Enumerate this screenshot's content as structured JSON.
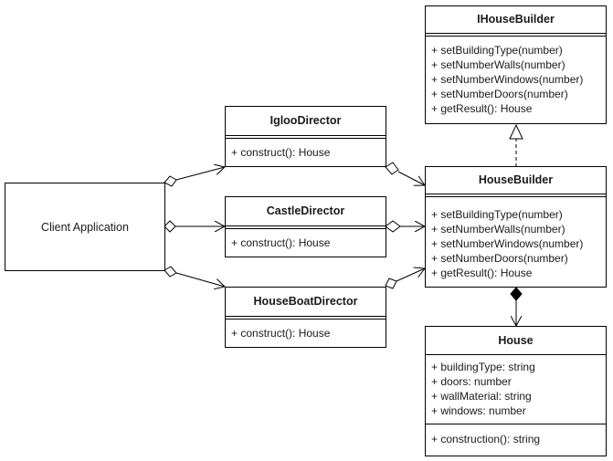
{
  "client": {
    "label": "Client Application"
  },
  "directors": [
    {
      "name": "IglooDirector",
      "methods": [
        "+ construct(): House"
      ]
    },
    {
      "name": "CastleDirector",
      "methods": [
        "+ construct(): House"
      ]
    },
    {
      "name": "HouseBoatDirector",
      "methods": [
        "+ construct(): House"
      ]
    }
  ],
  "interface": {
    "name": "IHouseBuilder",
    "methods": [
      "+ setBuildingType(number)",
      "+ setNumberWalls(number)",
      "+ setNumberWindows(number)",
      "+ setNumberDoors(number)",
      "+ getResult(): House"
    ]
  },
  "builder": {
    "name": "HouseBuilder",
    "methods": [
      "+ setBuildingType(number)",
      "+ setNumberWalls(number)",
      "+ setNumberWindows(number)",
      "+ setNumberDoors(number)",
      "+ getResult(): House"
    ]
  },
  "product": {
    "name": "House",
    "attributes": [
      "+ buildingType: string",
      "+ doors: number",
      "+ wallMaterial: string",
      "+ windows: number"
    ],
    "methods": [
      "+ construction(): string"
    ]
  }
}
